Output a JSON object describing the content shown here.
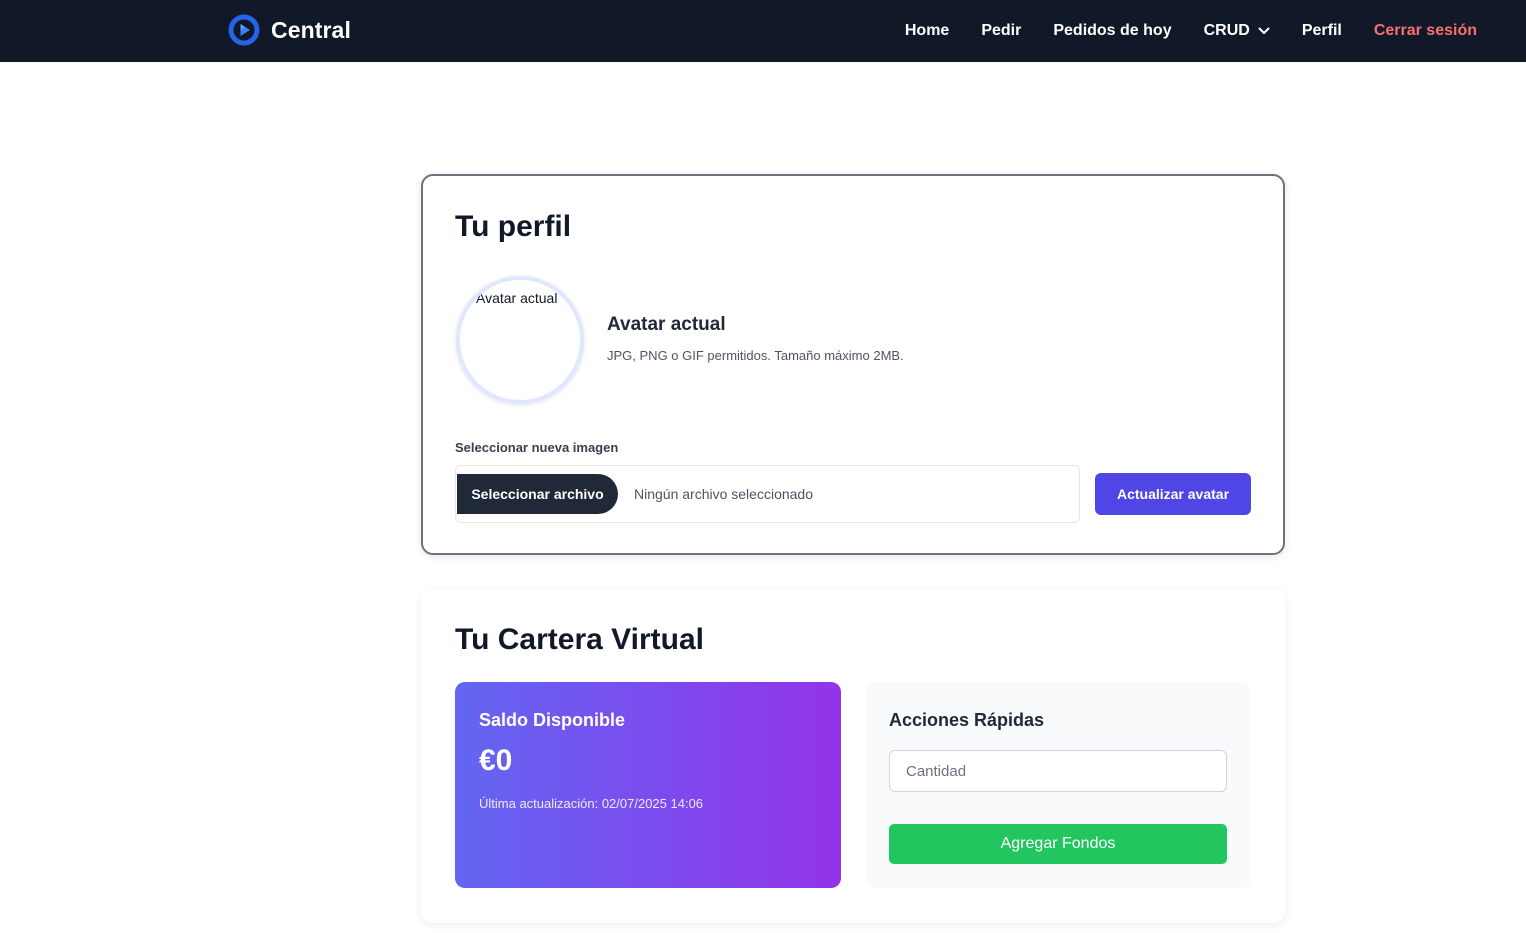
{
  "navbar": {
    "brand": "Central",
    "links": [
      {
        "label": "Home"
      },
      {
        "label": "Pedir"
      },
      {
        "label": "Pedidos de hoy"
      },
      {
        "label": "CRUD"
      },
      {
        "label": "Perfil"
      },
      {
        "label": "Cerrar sesión"
      }
    ],
    "logout_color": "#f87171",
    "background": "#111827"
  },
  "profile": {
    "title": "Tu perfil",
    "avatar_alt": "Avatar actual",
    "avatar_heading": "Avatar actual",
    "avatar_help": "JPG, PNG o GIF permitidos. Tamaño máximo 2MB.",
    "select_label": "Seleccionar nueva imagen",
    "file_button": "Seleccionar archivo",
    "file_status": "Ningún archivo seleccionado",
    "update_button": "Actualizar avatar",
    "accent_color": "#4f46e5"
  },
  "wallet": {
    "title": "Tu Cartera Virtual",
    "balance_label": "Saldo Disponible",
    "balance_amount": "€0",
    "last_update": "Última actualización: 02/07/2025 14:06",
    "quick_title": "Acciones Rápidas",
    "amount_placeholder": "Cantidad",
    "add_button": "Agregar Fondos",
    "gradient": [
      "#6366f1",
      "#9333ea"
    ],
    "add_color": "#22c55e"
  }
}
